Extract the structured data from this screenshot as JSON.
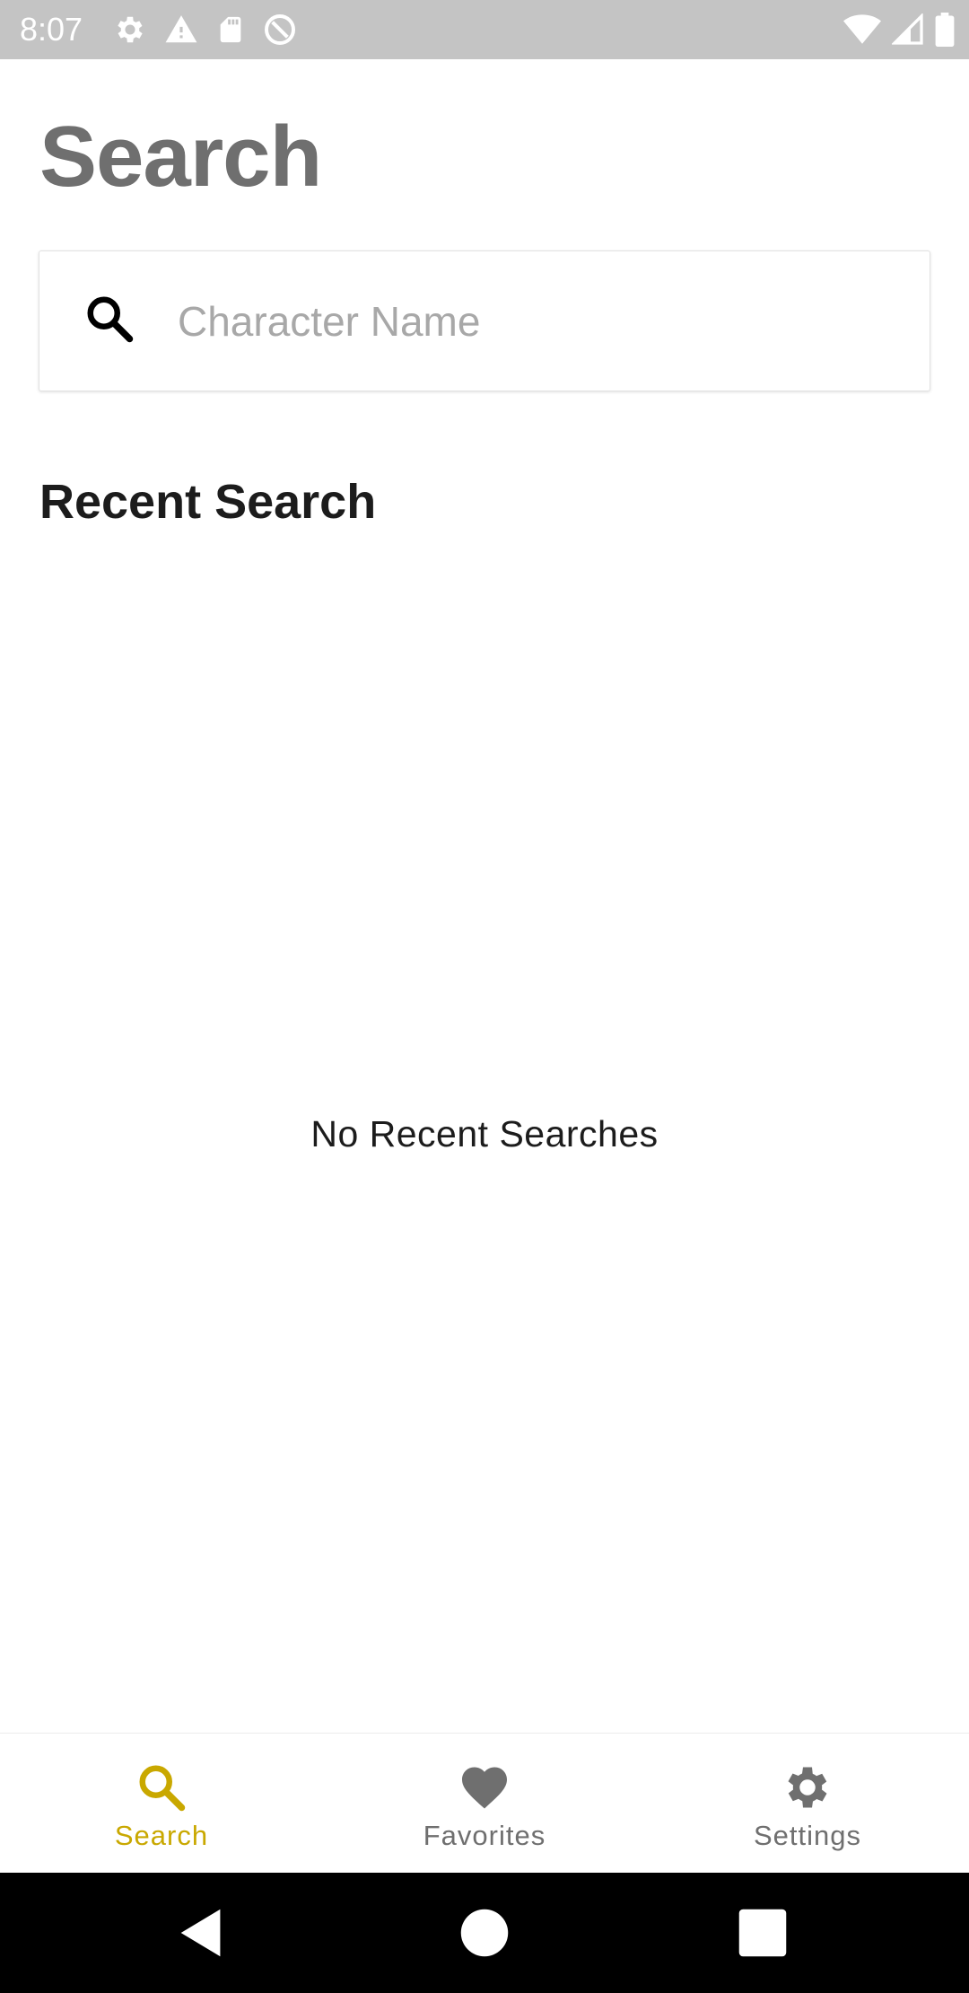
{
  "status_bar": {
    "time": "8:07",
    "icons_left": [
      "settings-icon",
      "warning-icon",
      "sd-card-icon",
      "at-sign-icon"
    ],
    "icons_right": [
      "wifi-icon",
      "cell-signal-icon",
      "battery-icon"
    ]
  },
  "page": {
    "title": "Search"
  },
  "search": {
    "placeholder": "Character Name",
    "value": "",
    "icon": "search-icon"
  },
  "recent": {
    "title": "Recent Search",
    "empty_message": "No Recent Searches"
  },
  "bottom_nav": {
    "items": [
      {
        "label": "Search",
        "icon": "search-icon",
        "active": true
      },
      {
        "label": "Favorites",
        "icon": "heart-icon",
        "active": false
      },
      {
        "label": "Settings",
        "icon": "gear-icon",
        "active": false
      }
    ],
    "active_color": "#c9a800",
    "inactive_color": "#6f6f6f"
  },
  "system_nav": {
    "buttons": [
      "back-icon",
      "home-icon",
      "recents-icon"
    ]
  }
}
